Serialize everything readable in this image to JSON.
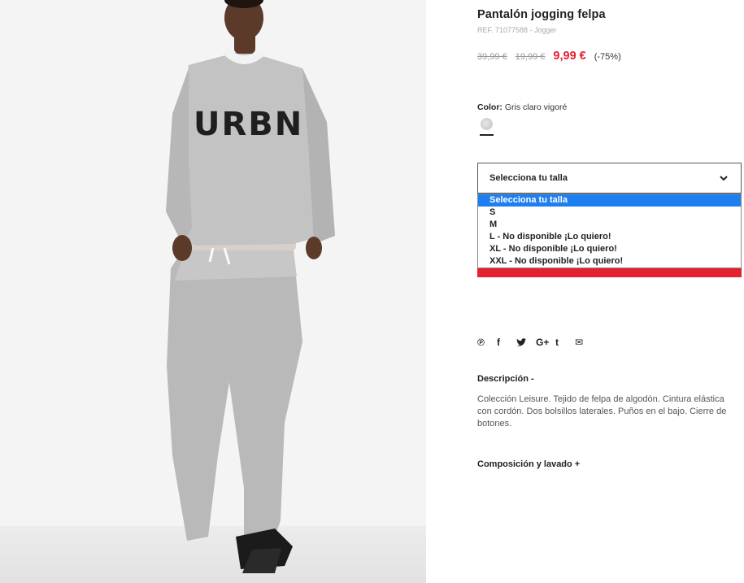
{
  "product": {
    "title": "Pantalón jogging felpa",
    "ref": "REF. 71077588 - Jogger",
    "old_prices": [
      "39,99 €",
      "19,99 €"
    ],
    "sale_price": "9,99 €",
    "discount": "(-75%)",
    "price_color": "#e3212f",
    "sweater_print": "URBN"
  },
  "color": {
    "label": "Color:",
    "value": "Gris claro vigoré"
  },
  "size": {
    "selected": "Selecciona tu talla",
    "options": [
      "Selecciona tu talla",
      "S",
      "M",
      "L - No disponible ¡Lo quiero!",
      "XL - No disponible ¡Lo quiero!",
      "XXL - No disponible ¡Lo quiero!"
    ],
    "highlight_color": "#1e7ff0"
  },
  "share": {
    "icons": [
      "pinterest-icon",
      "facebook-icon",
      "twitter-icon",
      "google-plus-icon",
      "tumblr-icon",
      "email-icon"
    ],
    "glyphs": [
      "℗",
      "f",
      "✔",
      "G+",
      "t",
      "✉"
    ]
  },
  "description": {
    "heading": "Descripción -",
    "text": "Colección Leisure. Tejido de felpa de algodón. Cintura elástica con cordón. Dos bolsillos laterales. Puños en el bajo. Cierre de botones."
  },
  "composition": {
    "heading": "Composición y lavado +"
  }
}
